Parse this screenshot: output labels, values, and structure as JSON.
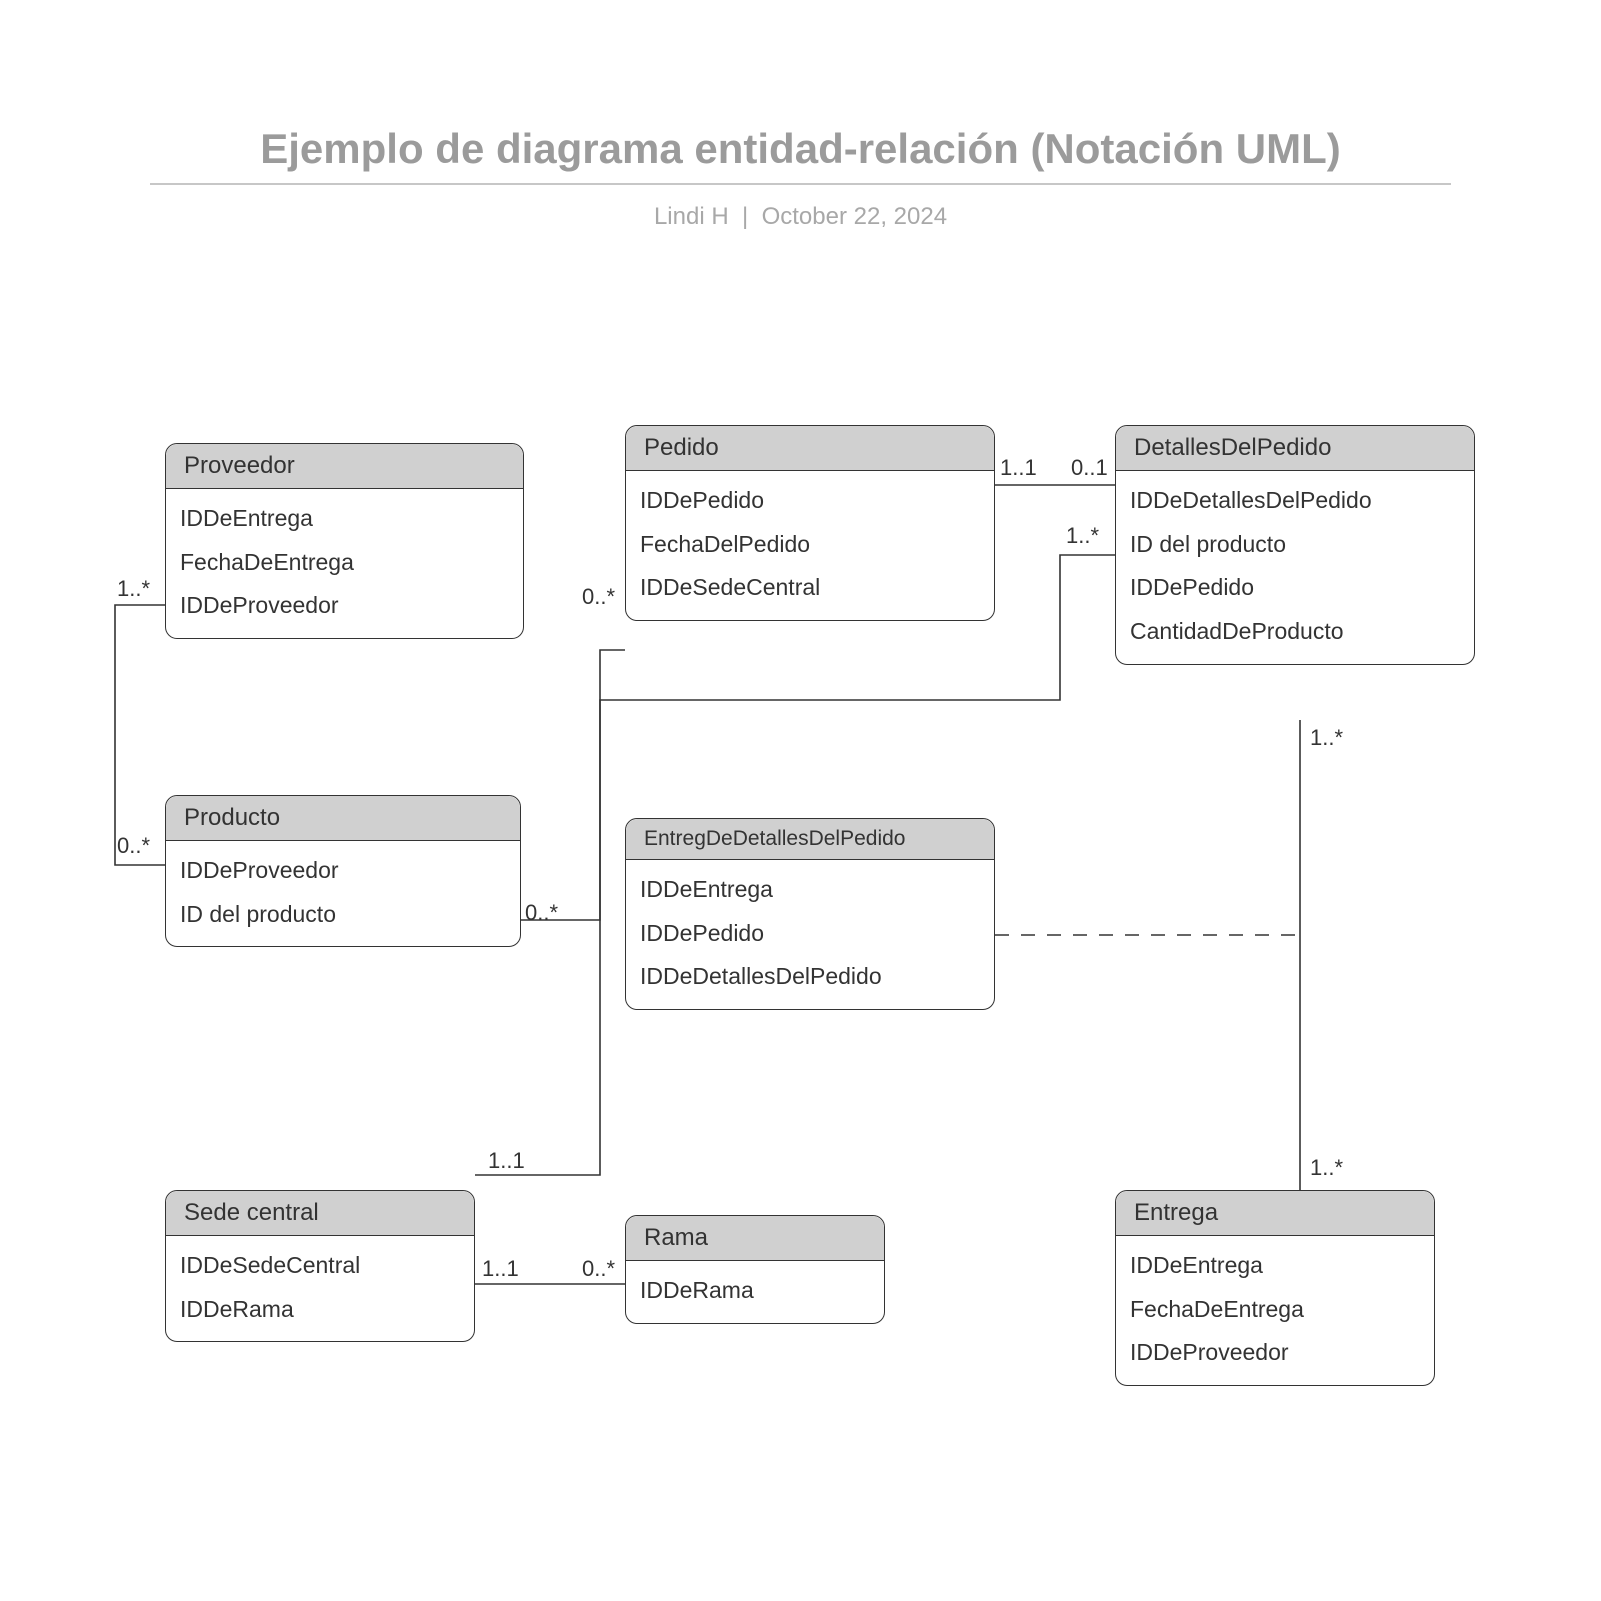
{
  "header": {
    "title": "Ejemplo de diagrama entidad-relación (Notación UML)",
    "author": "Lindi H",
    "separator": "|",
    "date": "October 22, 2024"
  },
  "entities": {
    "proveedor": {
      "name": "Proveedor",
      "attrs": [
        "IDDeEntrega",
        "FechaDeEntrega",
        "IDDeProveedor"
      ]
    },
    "pedido": {
      "name": "Pedido",
      "attrs": [
        "IDDePedido",
        "FechaDelPedido",
        "IDDeSedeCentral"
      ]
    },
    "detalles": {
      "name": "DetallesDelPedido",
      "attrs": [
        "IDDeDetallesDelPedido",
        "ID del producto",
        "IDDePedido",
        "CantidadDeProducto"
      ]
    },
    "producto": {
      "name": "Producto",
      "attrs": [
        "IDDeProveedor",
        "ID del producto"
      ]
    },
    "assoc": {
      "name": "EntregDeDetallesDelPedido",
      "attrs": [
        "IDDeEntrega",
        "IDDePedido",
        "IDDeDetallesDelPedido"
      ]
    },
    "sede": {
      "name": "Sede central",
      "attrs": [
        "IDDeSedeCentral",
        "IDDeRama"
      ]
    },
    "rama": {
      "name": "Rama",
      "attrs": [
        "IDDeRama"
      ]
    },
    "entrega": {
      "name": "Entrega",
      "attrs": [
        "IDDeEntrega",
        "FechaDeEntrega",
        "IDDeProveedor"
      ]
    }
  },
  "mult": {
    "prov_out": "1..*",
    "prov_to_prod": "0..*",
    "pedido_left": "0..*",
    "pedido_right": "1..1",
    "detalles_top": "0..1",
    "detalles_left": "1..*",
    "detalles_bottom": "1..*",
    "producto_right": "0..*",
    "sede_top": "1..1",
    "sede_right": "1..1",
    "rama_left": "0..*",
    "entrega_top": "1..*"
  }
}
